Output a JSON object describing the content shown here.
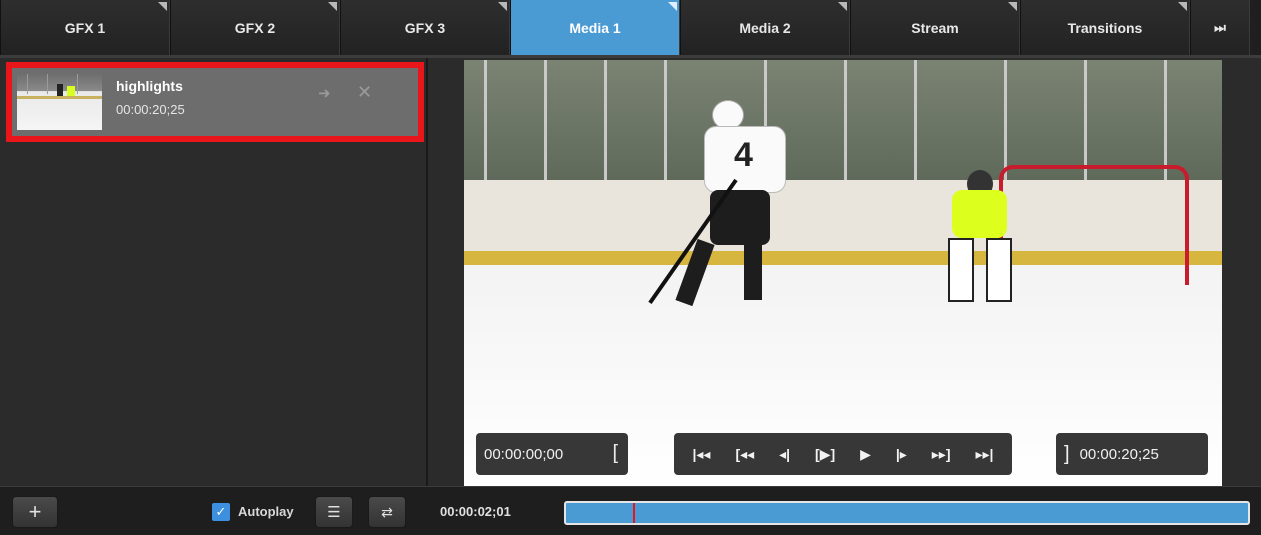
{
  "tabs": [
    {
      "label": "GFX 1",
      "active": false
    },
    {
      "label": "GFX 2",
      "active": false
    },
    {
      "label": "GFX 3",
      "active": false
    },
    {
      "label": "Media 1",
      "active": true
    },
    {
      "label": "Media 2",
      "active": false
    },
    {
      "label": "Stream",
      "active": false
    },
    {
      "label": "Transitions",
      "active": false
    }
  ],
  "tabs_more_icon": "skip-forward-icon",
  "media_list": {
    "items": [
      {
        "title": "highlights",
        "duration": "00:00:20;25",
        "selected": true
      }
    ]
  },
  "left_footer": {
    "add_label": "+",
    "autoplay_label": "Autoplay",
    "autoplay_checked": true
  },
  "preview": {
    "in_point": "00:00:00;00",
    "out_point": "00:00:20;25",
    "player_number": "4"
  },
  "timeline": {
    "current_time": "00:00:02;01",
    "progress_fraction": 0.098
  },
  "colors": {
    "accent": "#4a9ad4",
    "highlight_border": "#e8161b"
  }
}
